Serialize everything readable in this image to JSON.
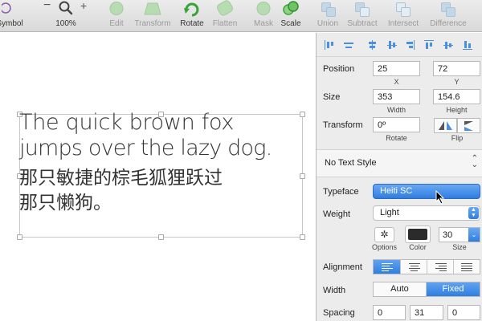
{
  "toolbar": {
    "items": [
      {
        "label": "Symbol",
        "icon": "symbol-icon",
        "enabled": true
      },
      {
        "label": "100%",
        "icon": "zoom-icon",
        "enabled": true,
        "zoom_controls": [
          "−",
          "+"
        ]
      },
      {
        "label": "Edit",
        "icon": "edit-icon",
        "enabled": false
      },
      {
        "label": "Transform",
        "icon": "transform-icon",
        "enabled": false
      },
      {
        "label": "Rotate",
        "icon": "rotate-icon",
        "enabled": true
      },
      {
        "label": "Flatten",
        "icon": "flatten-icon",
        "enabled": false
      },
      {
        "label": "Mask",
        "icon": "mask-icon",
        "enabled": false
      },
      {
        "label": "Scale",
        "icon": "scale-icon",
        "enabled": true
      },
      {
        "label": "Union",
        "icon": "union-icon",
        "enabled": false
      },
      {
        "label": "Subtract",
        "icon": "subtract-icon",
        "enabled": false
      },
      {
        "label": "Intersect",
        "icon": "intersect-icon",
        "enabled": false
      },
      {
        "label": "Difference",
        "icon": "difference-icon",
        "enabled": false
      }
    ]
  },
  "canvas": {
    "text_lines": [
      "The quick brown fox",
      "jumps over the lazy dog.",
      "那只敏捷的棕毛狐狸跃过",
      "那只懒狗。"
    ]
  },
  "inspector": {
    "position": {
      "label": "Position",
      "x": "25",
      "y": "72",
      "x_label": "X",
      "y_label": "Y"
    },
    "size": {
      "label": "Size",
      "width": "353",
      "height": "154.6",
      "width_label": "Width",
      "height_label": "Height"
    },
    "transform": {
      "label": "Transform",
      "rotate": "0º",
      "rotate_label": "Rotate",
      "flip_label": "Flip"
    },
    "text_style": {
      "value": "No Text Style"
    },
    "typeface": {
      "label": "Typeface",
      "value": "Heiti SC"
    },
    "weight": {
      "label": "Weight",
      "value": "Light"
    },
    "options": {
      "label": "Options",
      "color_label": "Color",
      "size_label": "Size",
      "size_value": "30",
      "color": "#2b2b2b"
    },
    "alignment": {
      "label": "Alignment",
      "selected": "left"
    },
    "width": {
      "label": "Width",
      "options": [
        "Auto",
        "Fixed"
      ],
      "selected": "Fixed"
    },
    "spacing": {
      "label": "Spacing",
      "values": [
        "0",
        "31",
        "0"
      ]
    }
  },
  "colors": {
    "accent": "#2f7de0",
    "toolbar_bg": "#dedede",
    "panel_bg": "#ececec"
  }
}
